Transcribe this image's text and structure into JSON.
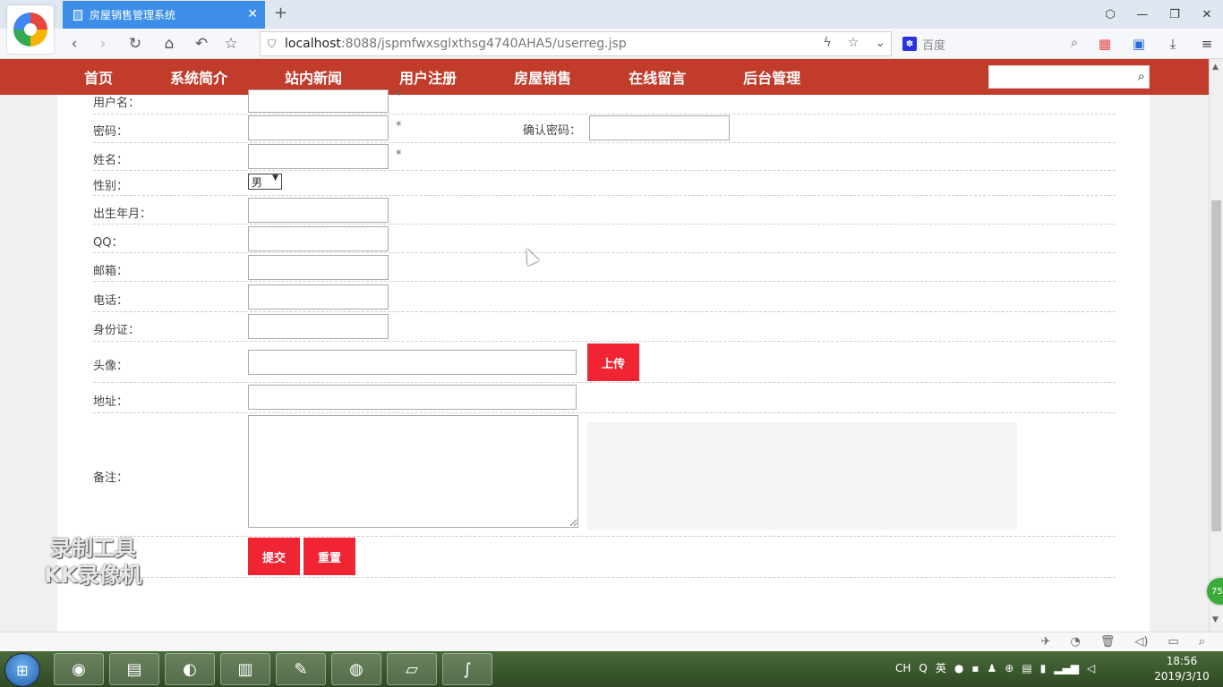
{
  "browser": {
    "tab_title": "房屋销售管理系统",
    "url_host": "localhost",
    "url_path": ":8088/jspmfwxsglxthsg4740AHA5/userreg.jsp",
    "search_engine_label": "百度"
  },
  "site_nav": {
    "items": [
      "首页",
      "系统简介",
      "站内新闻",
      "用户注册",
      "房屋销售",
      "在线留言",
      "后台管理"
    ]
  },
  "form": {
    "username_label": "用户名：",
    "password_label": "密码：",
    "confirm_password_label": "确认密码：",
    "name_label": "姓名：",
    "gender_label": "性别：",
    "gender_value": "男",
    "birth_label": "出生年月：",
    "qq_label": "QQ：",
    "email_label": "邮箱：",
    "phone_label": "电话：",
    "idcard_label": "身份证：",
    "avatar_label": "头像：",
    "upload_button": "上传",
    "address_label": "地址：",
    "remark_label": "备注：",
    "required_mark": "*",
    "submit_button": "提交",
    "reset_button": "重置"
  },
  "watermark": {
    "line1": "录制工具",
    "line2": "KK录像机"
  },
  "scroll_badge": "75",
  "taskbar": {
    "tray_lang": "CH",
    "tray_ime": "英",
    "time": "18:56",
    "date": "2019/3/10"
  }
}
